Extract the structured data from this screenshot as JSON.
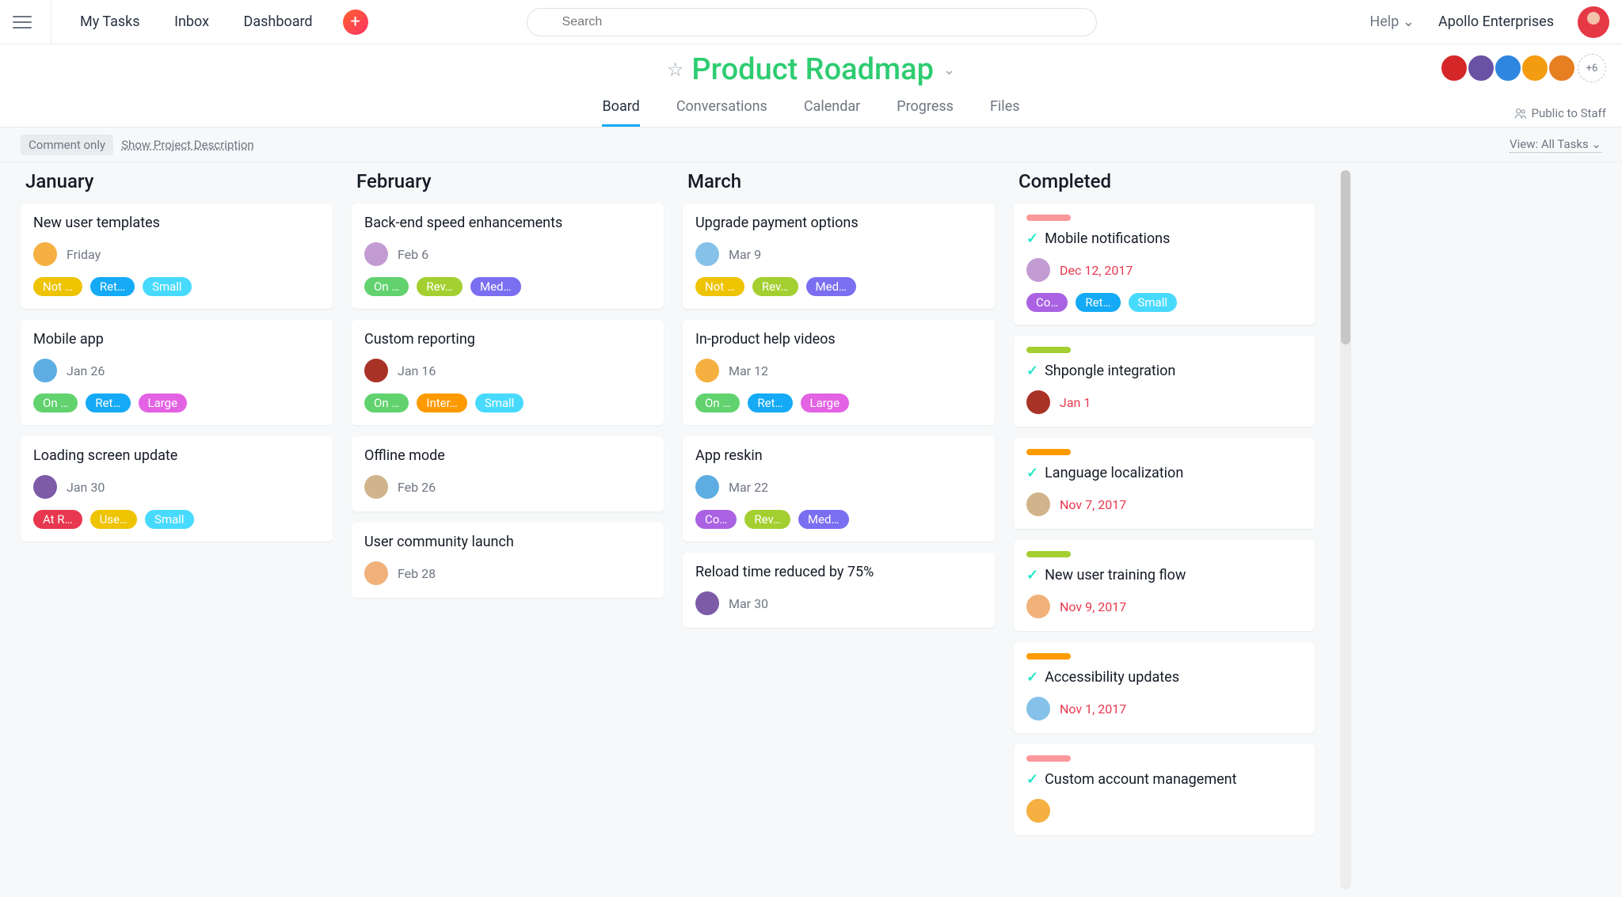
{
  "topbar": {
    "nav": {
      "my_tasks": "My Tasks",
      "inbox": "Inbox",
      "dashboard": "Dashboard"
    },
    "search_placeholder": "Search",
    "help": "Help",
    "org": "Apollo Enterprises"
  },
  "project": {
    "title": "Product Roadmap",
    "tabs": {
      "board": "Board",
      "conversations": "Conversations",
      "calendar": "Calendar",
      "progress": "Progress",
      "files": "Files"
    },
    "more_count": "+6",
    "privacy": "Public to Staff"
  },
  "toolbar": {
    "comment_only": "Comment only",
    "show_desc": "Show Project Description",
    "view": "View: All Tasks"
  },
  "columns": [
    {
      "title": "January",
      "cards": [
        {
          "title": "New user templates",
          "date": "Friday",
          "tags": [
            {
              "t": "Not …",
              "c": "c-yellow"
            },
            {
              "t": "Ret…",
              "c": "c-blue"
            },
            {
              "t": "Small",
              "c": "c-bluel"
            }
          ]
        },
        {
          "title": "Mobile app",
          "date": "Jan 26",
          "tags": [
            {
              "t": "On …",
              "c": "c-green"
            },
            {
              "t": "Ret…",
              "c": "c-blue"
            },
            {
              "t": "Large",
              "c": "c-pink"
            }
          ]
        },
        {
          "title": "Loading screen update",
          "date": "Jan 30",
          "tags": [
            {
              "t": "At R…",
              "c": "c-red"
            },
            {
              "t": "Use…",
              "c": "c-yellow"
            },
            {
              "t": "Small",
              "c": "c-bluel"
            }
          ]
        }
      ]
    },
    {
      "title": "February",
      "cards": [
        {
          "title": "Back-end speed enhancements",
          "date": "Feb 6",
          "tags": [
            {
              "t": "On …",
              "c": "c-green"
            },
            {
              "t": "Rev…",
              "c": "c-lime"
            },
            {
              "t": "Med…",
              "c": "c-purple"
            }
          ]
        },
        {
          "title": "Custom reporting",
          "date": "Jan 16",
          "tags": [
            {
              "t": "On …",
              "c": "c-green"
            },
            {
              "t": "Inter…",
              "c": "c-orange"
            },
            {
              "t": "Small",
              "c": "c-bluel"
            }
          ]
        },
        {
          "title": "Offline mode",
          "date": "Feb 26",
          "simple": true
        },
        {
          "title": "User community launch",
          "date": "Feb 28",
          "simple": true
        }
      ]
    },
    {
      "title": "March",
      "cards": [
        {
          "title": "Upgrade payment options",
          "date": "Mar 9",
          "tags": [
            {
              "t": "Not …",
              "c": "c-yellow"
            },
            {
              "t": "Rev…",
              "c": "c-lime"
            },
            {
              "t": "Med…",
              "c": "c-purple"
            }
          ]
        },
        {
          "title": "In-product help videos",
          "date": "Mar 12",
          "tags": [
            {
              "t": "On …",
              "c": "c-green"
            },
            {
              "t": "Ret…",
              "c": "c-blue"
            },
            {
              "t": "Large",
              "c": "c-pink"
            }
          ]
        },
        {
          "title": "App reskin",
          "date": "Mar 22",
          "tags": [
            {
              "t": "Co…",
              "c": "c-deeppurple"
            },
            {
              "t": "Rev…",
              "c": "c-lime"
            },
            {
              "t": "Med…",
              "c": "c-purple"
            }
          ]
        },
        {
          "title": "Reload time reduced by 75%",
          "date": "Mar 30",
          "simple": true
        }
      ]
    },
    {
      "title": "Completed",
      "cards": [
        {
          "strip": "s-pink",
          "done": true,
          "title": "Mobile notifications",
          "date": "Dec 12, 2017",
          "due": true,
          "tags": [
            {
              "t": "Co…",
              "c": "c-deeppurple"
            },
            {
              "t": "Ret…",
              "c": "c-blue"
            },
            {
              "t": "Small",
              "c": "c-bluel"
            }
          ]
        },
        {
          "strip": "s-lime",
          "done": true,
          "title": "Shpongle integration",
          "date": "Jan 1",
          "due": true,
          "simple": true
        },
        {
          "strip": "s-orange",
          "done": true,
          "title": "Language localization",
          "date": "Nov 7, 2017",
          "due": true,
          "simple": true
        },
        {
          "strip": "s-lime",
          "done": true,
          "title": "New user training flow",
          "date": "Nov 9, 2017",
          "due": true,
          "simple": true
        },
        {
          "strip": "s-orange",
          "done": true,
          "title": "Accessibility updates",
          "date": "Nov 1, 2017",
          "due": true,
          "simple": true
        },
        {
          "strip": "s-pink",
          "done": true,
          "title": "Custom account management",
          "date": "",
          "simple": true
        }
      ]
    }
  ],
  "avatar_classes": [
    "av0",
    "av1",
    "av2",
    "av3",
    "av4",
    "av5",
    "av6",
    "av7"
  ]
}
